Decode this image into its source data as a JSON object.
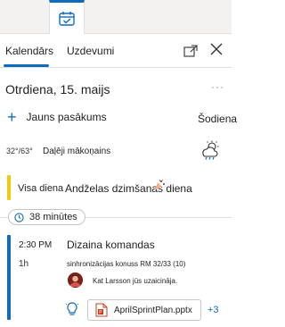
{
  "header": {
    "app_icon": "calendar-check-icon",
    "accent_color": "#0f6cbd"
  },
  "tabs": {
    "calendar": "Kalendārs",
    "tasks": "Uzdevumi",
    "popout_icon": "popout-icon",
    "close_icon": "close-icon"
  },
  "day": {
    "title": "Otrdiena, 15. maijs",
    "more": "···"
  },
  "actions": {
    "new_event": "Jauns pasākums",
    "today": "Šodiena"
  },
  "weather": {
    "temperature": "32°/63°",
    "description": "Daļēji mākoņains",
    "icon": "partly-cloudy-rain-icon"
  },
  "all_day": {
    "label": "Visa diena",
    "title": "Andželas dzimšanas diena",
    "color": "#f2c811"
  },
  "countdown": {
    "text": "38 minūtes"
  },
  "event": {
    "time": "2:30 PM",
    "duration": "1h",
    "title": "Dizaina komandas",
    "location": "sinhronizācijas konuss RM 32/33 (10)",
    "organizer": "Kat Larsson jūs uzaicināja.",
    "color": "#0f6cbd",
    "attachment": "AprilSprintPlan.pptx",
    "more_attachments": "+3"
  }
}
